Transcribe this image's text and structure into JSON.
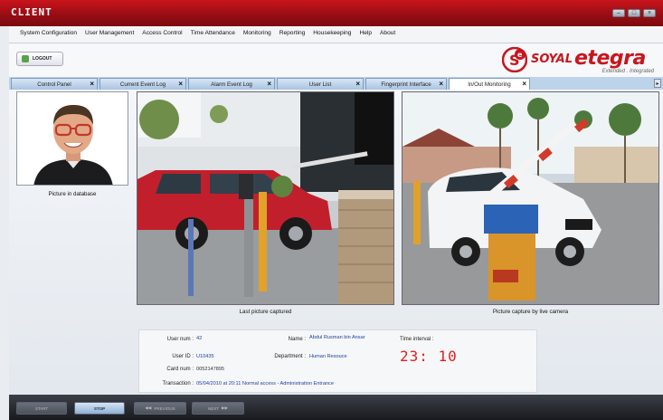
{
  "window": {
    "title": "CLIENT"
  },
  "menu": [
    "System Configuration",
    "User Management",
    "Access Control",
    "Time Attendance",
    "Monitoring",
    "Reporting",
    "Housekeeping",
    "Help",
    "About"
  ],
  "toolbar": {
    "logout_label": "LOGOUT"
  },
  "brand": {
    "soyal": "SOYAL",
    "etegra": "etegra",
    "tagline": "Extended . Integrated"
  },
  "tabs": [
    {
      "label": "Control Panel",
      "close": "×"
    },
    {
      "label": "Current Event Log",
      "close": "×"
    },
    {
      "label": "Alarm Event Log",
      "close": "×"
    },
    {
      "label": "User List",
      "close": "×"
    },
    {
      "label": "Fingerprint Interface",
      "close": "×"
    },
    {
      "label": "In/Out Monitoring",
      "close": "×",
      "active": true
    }
  ],
  "panels": {
    "database_caption": "Picture in database",
    "last_caption": "Last picture captured",
    "live_caption": "Picture capture by live camera"
  },
  "info": {
    "user_num_label": "User num :",
    "user_num": "42",
    "user_id_label": "User ID :",
    "user_id": "U10435",
    "card_num_label": "Card num :",
    "card_num": "0052147895",
    "transaction_label": "Transaction :",
    "transaction": "05/04/2010 at 20:11 Normal access - Administration Entrance",
    "name_label": "Name :",
    "name": "Abdul Rusman bin Ansar",
    "department_label": "Department :",
    "department": "Human Resouce",
    "time_interval_label": "Time interval :",
    "time_interval": "23: 10"
  },
  "footer": {
    "start": "START",
    "stop": "STOP",
    "previous": "PREVIOUS",
    "next": "NEXT",
    "previous_icon": "rewind-icon",
    "next_icon": "fast-forward-icon"
  },
  "colors": {
    "brand_red": "#c8161d",
    "timer_red": "#e21e1e",
    "value_blue": "#1e3fa0"
  }
}
